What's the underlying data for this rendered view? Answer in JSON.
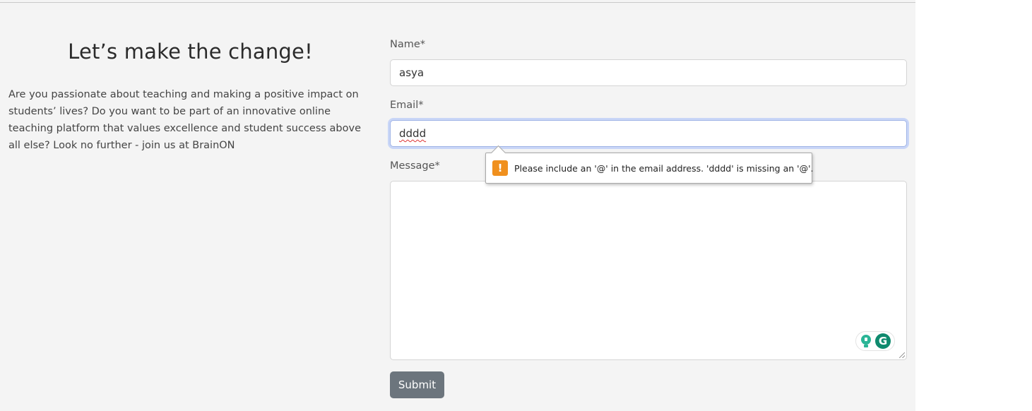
{
  "intro": {
    "heading": "Let’s make the change!",
    "paragraph": "Are you passionate about teaching and making a positive impact on students’ lives? Do you want to be part of an innovative online teaching platform that values excellence and student success above all else? Look no further - join us at BrainON"
  },
  "form": {
    "name_label": "Name*",
    "name_value": "asya",
    "email_label": "Email*",
    "email_value": "dddd",
    "message_label": "Message*",
    "message_value": "",
    "submit_label": "Submit"
  },
  "validation": {
    "message": "Please include an '@' in the email address. 'dddd' is missing an '@'.",
    "icon": "exclamation-warning-icon",
    "icon_color": "#f0901e"
  },
  "extension": {
    "bulb_icon": "lightbulb-icon",
    "logo_icon": "grammarly-icon",
    "logo_glyph": "G",
    "color": "#0f8a6e"
  },
  "colors": {
    "button": "#6c757d",
    "background": "#f4f4f4",
    "focus_ring": "#c9d6f7"
  }
}
